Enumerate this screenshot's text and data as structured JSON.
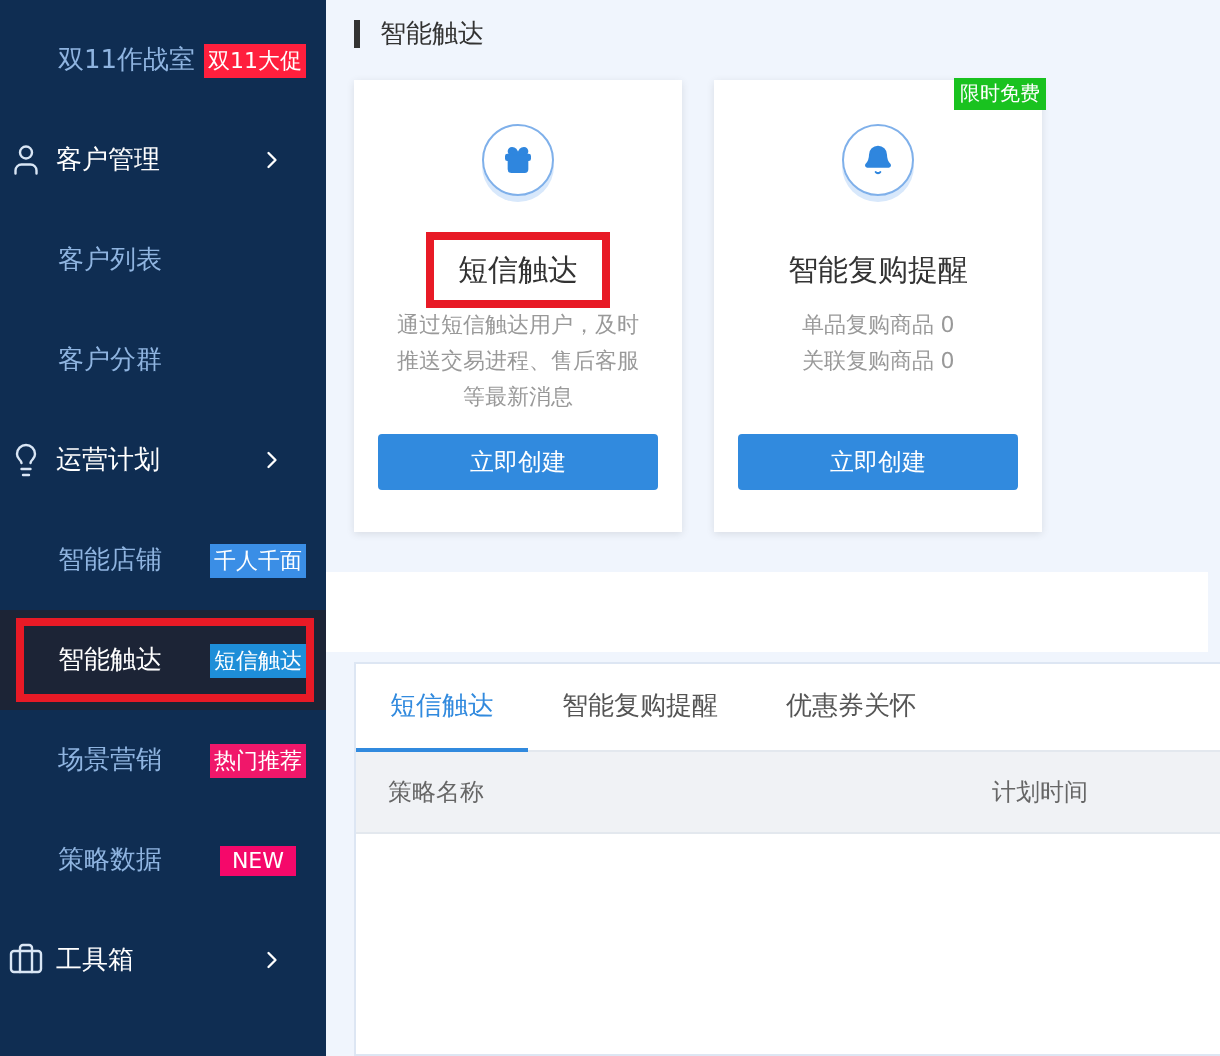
{
  "sidebar": {
    "items": [
      {
        "kind": "link",
        "label": "双11作战室",
        "selected": false,
        "highlighted": false,
        "badge": {
          "text": "双11大促",
          "color": "#ff1f3d"
        }
      },
      {
        "kind": "group",
        "label": "客户管理"
      },
      {
        "kind": "link",
        "label": "客户列表",
        "selected": false,
        "highlighted": false
      },
      {
        "kind": "link",
        "label": "客户分群",
        "selected": false,
        "highlighted": false
      },
      {
        "kind": "group",
        "label": "运营计划"
      },
      {
        "kind": "link",
        "label": "智能店铺",
        "selected": false,
        "highlighted": false,
        "badge": {
          "text": "千人千面",
          "color": "#3a8ee6"
        }
      },
      {
        "kind": "link",
        "label": "智能触达",
        "selected": true,
        "highlighted": true,
        "badge": {
          "text": "短信触达",
          "color": "#1e8ed8"
        }
      },
      {
        "kind": "link",
        "label": "场景营销",
        "selected": false,
        "highlighted": false,
        "badge": {
          "text": "热门推荐",
          "color": "#f0176a"
        }
      },
      {
        "kind": "link",
        "label": "策略数据",
        "selected": false,
        "highlighted": false,
        "badge": {
          "text": "NEW",
          "color": "#f5086a"
        }
      },
      {
        "kind": "group",
        "label": "工具箱"
      }
    ]
  },
  "page_title": "智能触达",
  "cards": [
    {
      "title": "短信触达",
      "title_highlighted": true,
      "lines": [
        "通过短信触达用户，及时",
        "推送交易进程、售后客服",
        "等最新消息"
      ],
      "button": "立即创建"
    },
    {
      "title": "智能复购提醒",
      "title_highlighted": false,
      "lines": [
        "单品复购商品 0",
        "关联复购商品 0"
      ],
      "button": "立即创建",
      "badge": {
        "text": "限时免费"
      }
    }
  ],
  "tabs": [
    {
      "label": "短信触达",
      "selected": true
    },
    {
      "label": "智能复购提醒",
      "selected": false
    },
    {
      "label": "优惠券关怀",
      "selected": false
    }
  ],
  "table": {
    "columns": [
      "策略名称",
      "计划时间"
    ]
  }
}
